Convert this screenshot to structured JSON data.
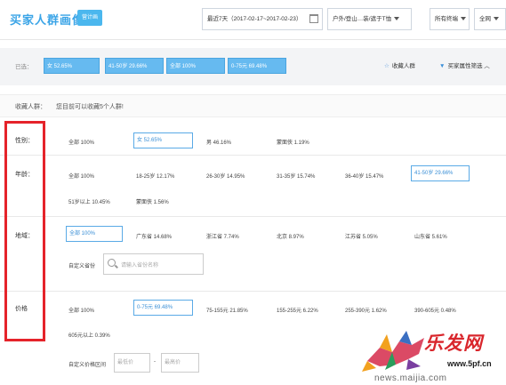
{
  "header": {
    "title": "买家人群画像",
    "badge": "营计画",
    "date_range": "最近7天（2017-02-17~2017-02-23）",
    "category": "户外/登山…装/遮于T恤",
    "terminal": "所有终端",
    "network": "全网"
  },
  "selected": {
    "label": "已选：",
    "chips": [
      "女 52.65%",
      "41-50岁 29.66%",
      "全部 100%",
      "0-75元 69.48%"
    ],
    "fav_action": "收藏人群",
    "filter_action": "买家属性筛选"
  },
  "favorite": {
    "label": "收藏人群：",
    "note": "您目前可以收藏5个人群!"
  },
  "gender": {
    "label": "性别：",
    "options": [
      "全部 100%",
      "女 52.65%",
      "男 46.16%",
      "蒙面侠 1.19%"
    ]
  },
  "age": {
    "label": "年龄：",
    "row1": [
      "全部 100%",
      "18-25岁 12.17%",
      "26-30岁 14.95%",
      "31-35岁 15.74%",
      "36-40岁 15.47%",
      "41-50岁 29.66%"
    ],
    "row2": [
      "51岁以上 10.45%",
      "蒙面侠 1.56%"
    ]
  },
  "region": {
    "label": "地域：",
    "options": [
      "全部 100%",
      "广东省 14.68%",
      "浙江省 7.74%",
      "北京 8.97%",
      "江苏省 5.05%",
      "山东省 5.61%"
    ],
    "custom_label": "自定义省份",
    "search_placeholder": "请输入省份名称"
  },
  "price": {
    "label": "价格",
    "row1": [
      "全部 100%",
      "0-75元 69.48%",
      "75-155元 21.85%",
      "155-255元 6.22%",
      "255-390元 1.62%",
      "390-605元 0.48%"
    ],
    "row2": [
      "605元以上 0.39%"
    ],
    "custom_label": "自定义价格区间",
    "min_placeholder": "最低价",
    "max_placeholder": "最高价",
    "separator": "-"
  },
  "watermark": {
    "cn": "乐发网",
    "url1": "www.5pf.cn",
    "url2": "news.maijia.com"
  },
  "colors": {
    "accent": "#3aa4e7",
    "chip_bg": "#66baf0",
    "highlight": "#e5232a"
  }
}
